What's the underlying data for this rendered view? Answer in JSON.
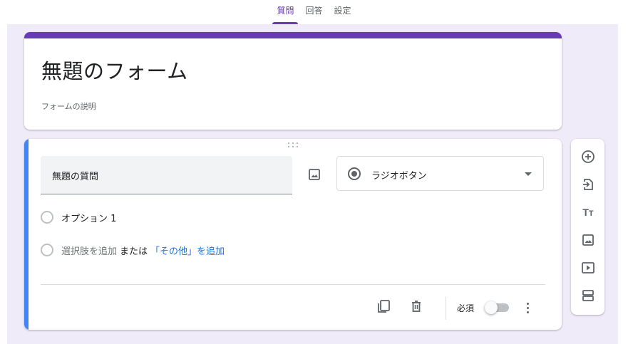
{
  "tabs": [
    {
      "label": "質問",
      "active": true
    },
    {
      "label": "回答",
      "active": false
    },
    {
      "label": "設定",
      "active": false
    }
  ],
  "form": {
    "title": "無題のフォーム",
    "description": "フォームの説明"
  },
  "question": {
    "title": "無題の質問",
    "type_label": "ラジオボタン",
    "option1": "オプション 1",
    "add_option": "選択肢を追加",
    "or": "または",
    "add_other": "「その他」を追加",
    "required_label": "必須"
  },
  "toolbar_icons": [
    "add-question-icon",
    "import-questions-icon",
    "add-title-icon",
    "add-image-icon",
    "add-video-icon",
    "add-section-icon"
  ],
  "colors": {
    "accent": "#673ab7",
    "background": "#f0ebf8",
    "active_question": "#4285f4",
    "link": "#1a73e8"
  }
}
